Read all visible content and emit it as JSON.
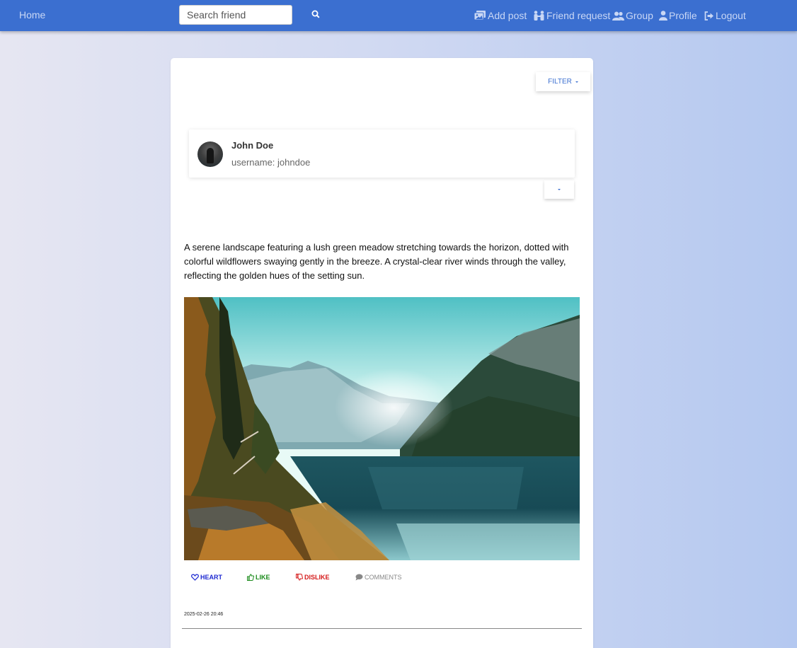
{
  "nav": {
    "home": "Home",
    "search_placeholder": "Search friend",
    "search_icon": "search-icon",
    "add_post": "Add post",
    "friend_request": "Friend request",
    "group": "Group",
    "profile": "Profile",
    "logout": "Logout"
  },
  "feed": {
    "filter_label": "FILTER"
  },
  "post": {
    "author_name": "John Doe",
    "author_username": "username: johndoe",
    "text": "A serene landscape featuring a lush green meadow stretching towards the horizon, dotted with colorful wildflowers swaying gently in the breeze. A crystal-clear river winds through the valley, reflecting the golden hues of the setting sun.",
    "actions": {
      "heart": "HEART",
      "like": "LIKE",
      "dislike": "DISLIKE",
      "comments": "COMMENTS"
    },
    "timestamp": "2025-02-26 20:46"
  },
  "colors": {
    "navbar": "#3b6fd0",
    "heart": "#1e2ad2",
    "like": "#1a8a1a",
    "dislike": "#d51a1a",
    "comments": "#888888"
  }
}
